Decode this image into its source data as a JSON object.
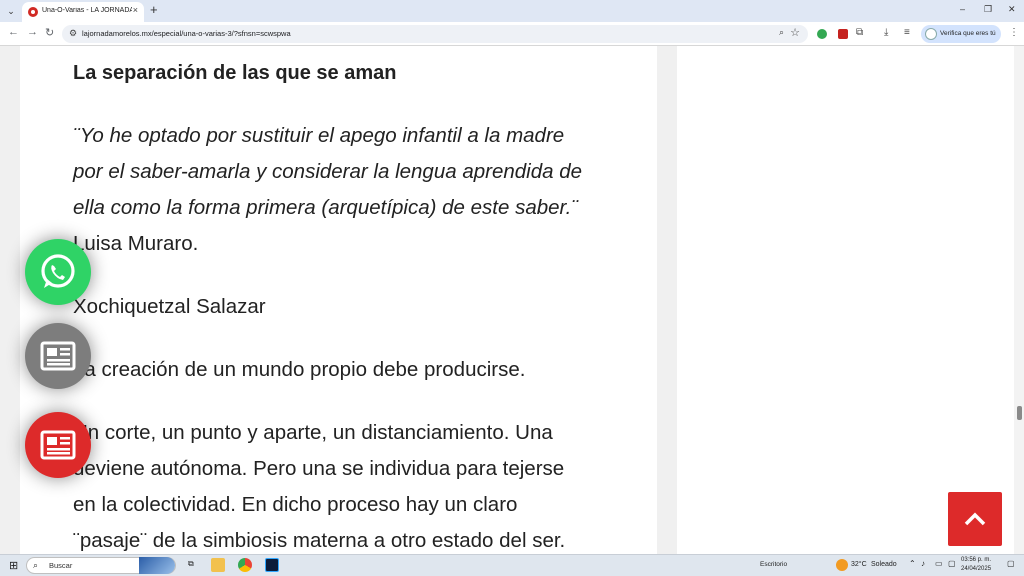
{
  "browser": {
    "tab_title": "Una-O-Varias - LA JORNADA M",
    "tab_close": "×",
    "new_tab": "+",
    "url": "lajornadamorelos.mx/especial/una-o-varias-3/?sfnsn=scwspwa",
    "verify_label": "Verifica que eres tú",
    "window_controls": [
      "–",
      "❐",
      "✕"
    ]
  },
  "article": {
    "heading": "La separación de las que se aman",
    "quote_lines": [
      "¨Yo he optado por sustituir el apego infantil a la madre",
      "por el saber-amarla y considerar la lengua aprendida de",
      "ella como la forma primera (arquetípica) de este saber.¨"
    ],
    "quote_author": "Luisa Muraro.",
    "author": "Xochiquetzal Salazar",
    "para1": "La creación de un mundo propio debe producirse.",
    "para2_lines": [
      "Un corte, un punto y aparte, un distanciamiento. Una",
      "deviene autónoma. Pero una se individua para tejerse",
      "en la colectividad. En dicho proceso hay un claro",
      "¨pasaje¨ de la simbiosis materna a otro estado del ser."
    ]
  },
  "colors": {
    "whatsapp": "#2fd366",
    "news_gray": "#7d7d7d",
    "news_red": "#dd2a2a",
    "to_top": "#dd2a2a"
  },
  "taskbar": {
    "search_label": "Buscar",
    "desktop_label": "Escritorio",
    "temperature": "32°C",
    "weather": "Soleado",
    "time": "03:56 p. m.",
    "date": "24/04/2025"
  }
}
